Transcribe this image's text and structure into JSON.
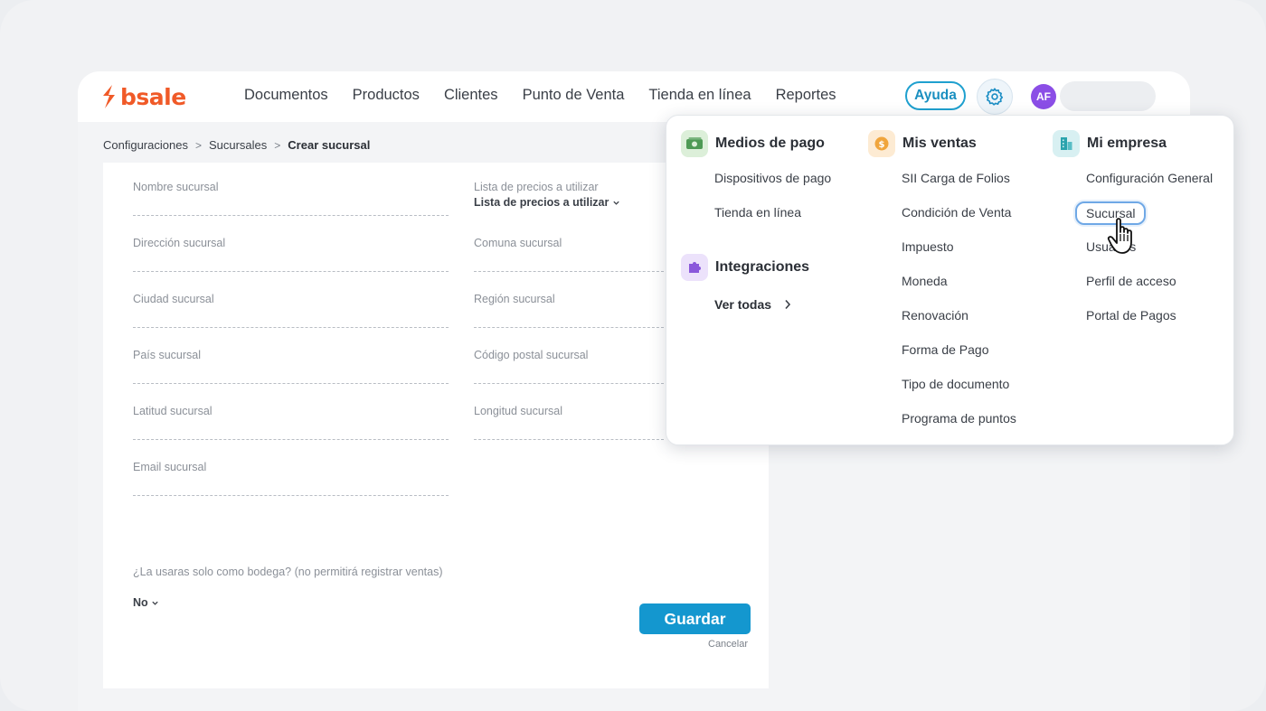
{
  "brand": {
    "name": "bsale",
    "color": "#f05a28"
  },
  "nav": {
    "items": [
      "Documentos",
      "Productos",
      "Clientes",
      "Punto de Venta",
      "Tienda en línea",
      "Reportes"
    ],
    "help_label": "Ayuda",
    "settings_icon": "gear-icon",
    "avatar_initials": "AF",
    "accent": "#1497cf"
  },
  "breadcrumb": {
    "items": [
      "Configuraciones",
      "Sucursales"
    ],
    "current": "Crear sucursal"
  },
  "form": {
    "fields": {
      "nombre": "Nombre sucursal",
      "lista_label": "Lista de precios a utilizar",
      "lista_value": "Lista de precios a utilizar",
      "direccion": "Dirección sucursal",
      "comuna": "Comuna sucursal",
      "ciudad": "Ciudad sucursal",
      "region": "Región sucursal",
      "pais": "País sucursal",
      "codigo_postal": "Código postal sucursal",
      "latitud": "Latitud sucursal",
      "longitud": "Longitud sucursal",
      "email": "Email sucursal"
    },
    "bodega_question": "¿La usaras solo como bodega? (no permitirá registrar ventas)",
    "bodega_value": "No",
    "save_label": "Guardar",
    "cancel_label": "Cancelar"
  },
  "menu": {
    "medios_de_pago": {
      "title": "Medios de pago",
      "icon": "cash-icon",
      "items": [
        "Dispositivos de pago",
        "Tienda en línea"
      ]
    },
    "integraciones": {
      "title": "Integraciones",
      "icon": "puzzle-icon",
      "see_all": "Ver todas"
    },
    "mis_ventas": {
      "title": "Mis ventas",
      "icon": "coin-icon",
      "items": [
        "SII Carga de Folios",
        "Condición de Venta",
        "Impuesto",
        "Moneda",
        "Renovación",
        "Forma de Pago",
        "Tipo de documento",
        "Programa de puntos"
      ]
    },
    "mi_empresa": {
      "title": "Mi empresa",
      "icon": "building-icon",
      "items": [
        "Configuración General",
        "Sucursal",
        "Usuarios",
        "Perfil de acceso",
        "Portal de Pagos"
      ]
    }
  }
}
